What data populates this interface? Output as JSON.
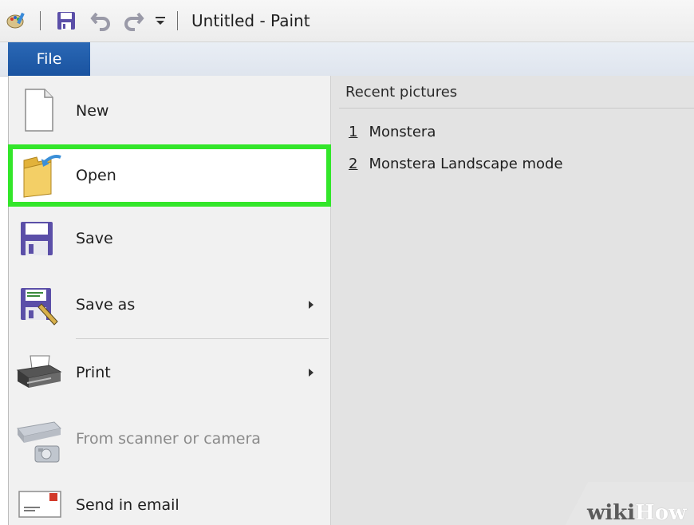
{
  "window": {
    "title": "Untitled - Paint"
  },
  "ribbon": {
    "file_tab_label": "File"
  },
  "file_menu": {
    "items": [
      {
        "label": "New",
        "icon": "new-document-icon"
      },
      {
        "label": "Open",
        "icon": "open-folder-icon"
      },
      {
        "label": "Save",
        "icon": "save-disk-icon"
      },
      {
        "label": "Save as",
        "icon": "save-as-icon"
      },
      {
        "label": "Print",
        "icon": "printer-icon"
      },
      {
        "label": "From scanner or camera",
        "icon": "scanner-icon"
      },
      {
        "label": "Send in email",
        "icon": "email-icon"
      }
    ]
  },
  "recent": {
    "header": "Recent pictures",
    "items": [
      {
        "number": "1",
        "name": "Monstera"
      },
      {
        "number": "2",
        "name": "Monstera Landscape mode"
      }
    ]
  },
  "watermark": {
    "part1": "wiki",
    "part2": "How"
  },
  "colors": {
    "highlight": "#33e62a",
    "file_tab": "#1a53a0"
  }
}
